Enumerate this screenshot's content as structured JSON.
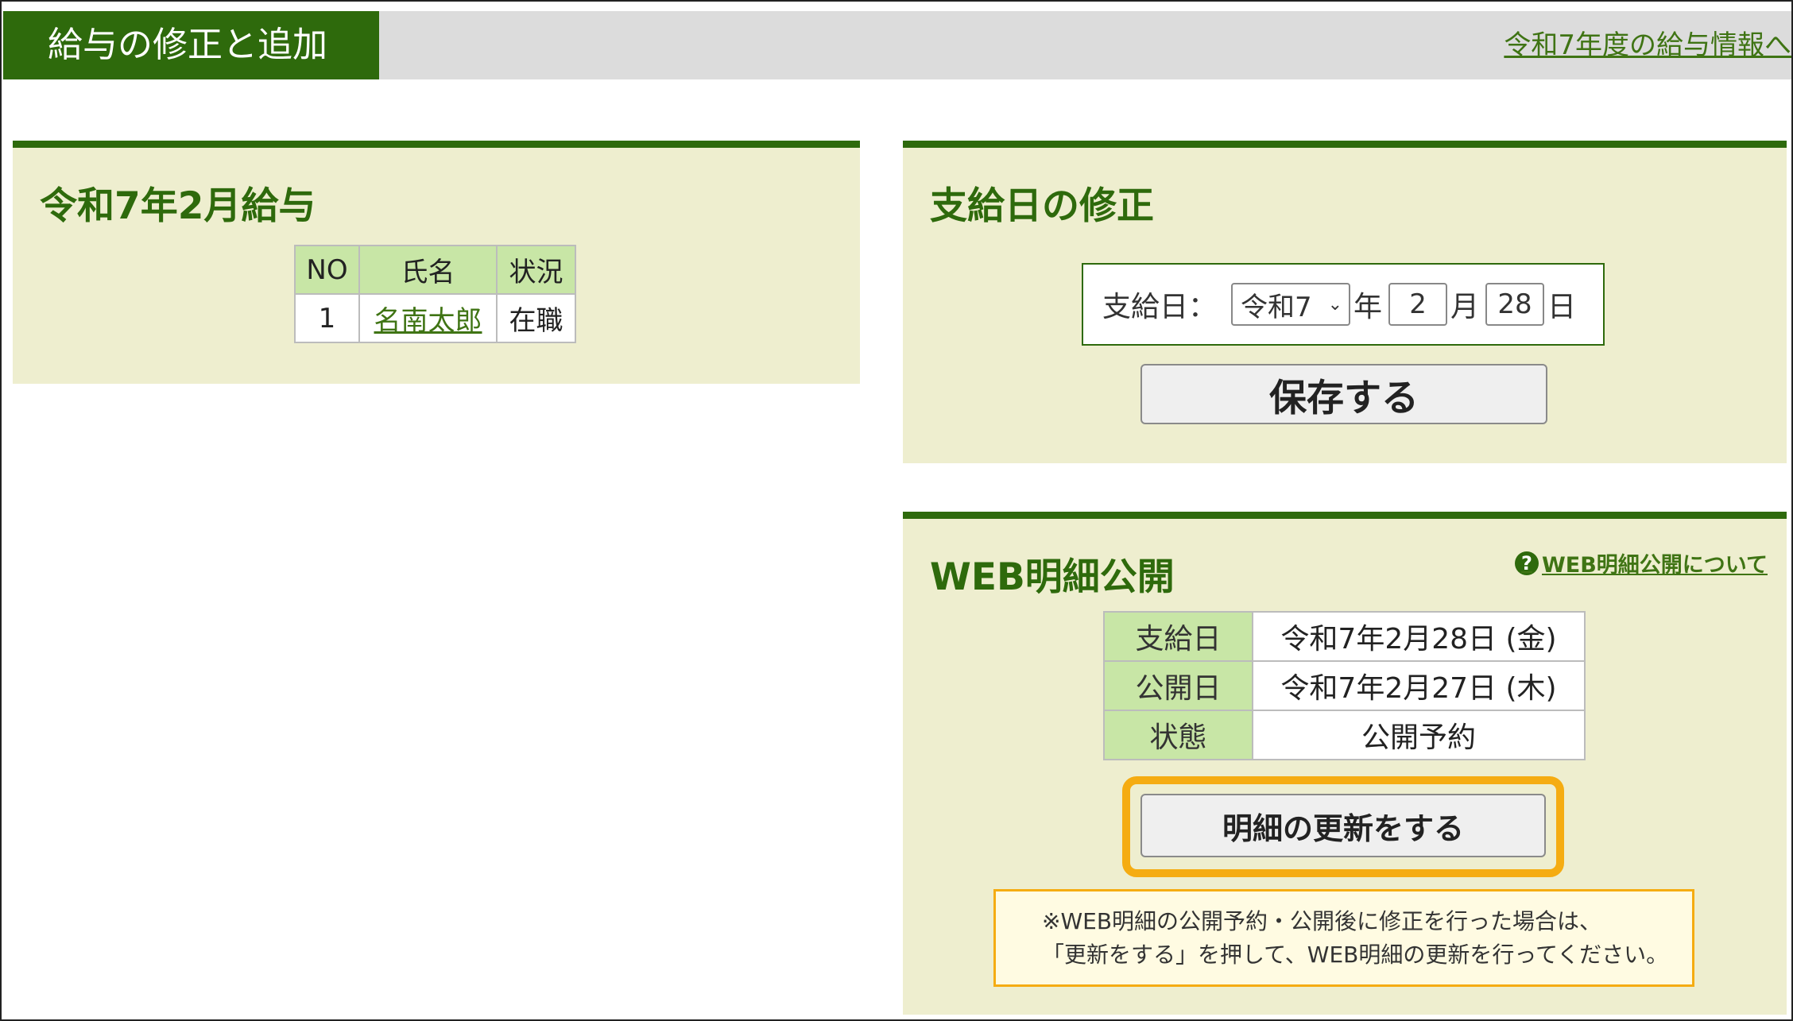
{
  "header": {
    "title": "給与の修正と追加",
    "link": "令和7年度の給与情報へ"
  },
  "salary_panel": {
    "heading": "令和7年2月給与",
    "columns": [
      "NO",
      "氏名",
      "状況"
    ],
    "rows": [
      {
        "no": "1",
        "name": "名南太郎",
        "status": "在職"
      }
    ]
  },
  "date_panel": {
    "heading": "支給日の修正",
    "label": "支給日：",
    "era": "令和7",
    "year_unit": "年",
    "month": "2",
    "month_unit": "月",
    "day": "28",
    "day_unit": "日",
    "save_label": "保存する"
  },
  "web_panel": {
    "heading": "WEB明細公開",
    "help_icon": "?",
    "help_link": "WEB明細公開について",
    "rows": [
      {
        "label": "支給日",
        "value": "令和7年2月28日 (金)"
      },
      {
        "label": "公開日",
        "value": "令和7年2月27日 (木)"
      },
      {
        "label": "状態",
        "value": "公開予約"
      }
    ],
    "update_label": "明細の更新をする",
    "notice_line1": "※WEB明細の公開予約・公開後に修正を行った場合は、",
    "notice_line2": "「更新をする」を押して、WEB明細の更新を行ってください。"
  },
  "colors": {
    "brand_green": "#2e6a0c",
    "panel_bg": "#eeeecf",
    "header_cell": "#c8e6a6",
    "highlight": "#f5ac12"
  }
}
